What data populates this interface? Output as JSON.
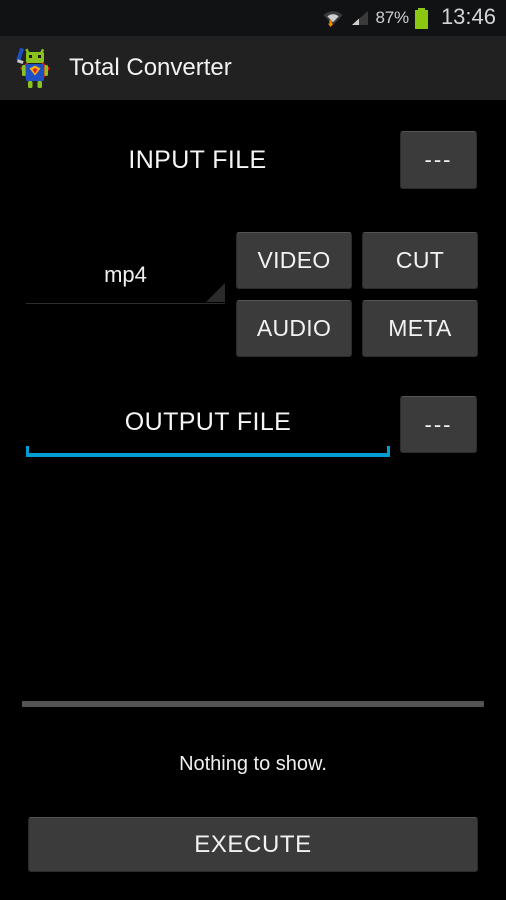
{
  "status_bar": {
    "wifi_icon": "wifi-with-download-arrow-icon",
    "signal_icon": "cellular-signal-icon",
    "battery_percent": "87%",
    "battery_icon": "battery-full-icon",
    "battery_color": "#8cc711",
    "clock": "13:46"
  },
  "action_bar": {
    "app_icon": "superhero-android-robot-icon",
    "title": "Total Converter",
    "background": "#212121"
  },
  "main": {
    "input_row": {
      "label": "INPUT FILE",
      "pick_button": "---"
    },
    "format_spinner": {
      "value": "mp4",
      "caret_icon": "dropdown-caret-icon"
    },
    "action_buttons": [
      {
        "label": "VIDEO"
      },
      {
        "label": "CUT"
      },
      {
        "label": "AUDIO"
      },
      {
        "label": "META"
      }
    ],
    "output_row": {
      "value": "OUTPUT FILE",
      "placeholder": "OUTPUT FILE",
      "underline_color": "#009dd4",
      "pick_button": "---"
    },
    "list_empty_text": "Nothing to show.",
    "execute_button": "EXECUTE"
  },
  "theme": {
    "background": "#000000",
    "button_face": "#3b3b3b",
    "text_primary": "#f5f5f5",
    "accent": "#009dd4"
  }
}
